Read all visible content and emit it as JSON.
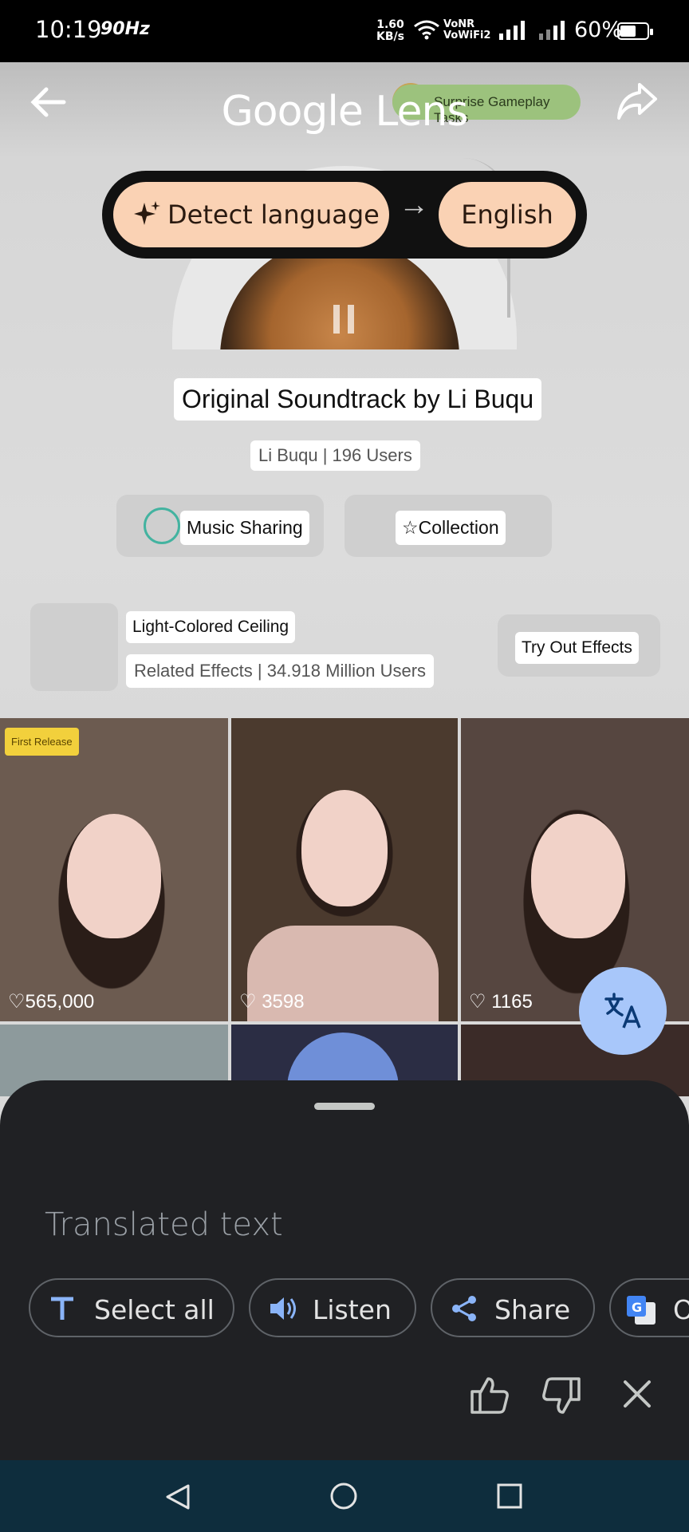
{
  "status_bar": {
    "time": "10:19",
    "refresh": "90Hz",
    "net_speed_value": "1.60",
    "net_speed_unit": "KB/s",
    "volte_top": "VoNR",
    "volte_bottom": "VoWiFi2",
    "battery": "60%",
    "battery_level": 0.6
  },
  "header": {
    "title": "Google Lens",
    "back_icon": "back-arrow-icon",
    "share_icon": "share-icon",
    "surprise_label": "Surprise Gameplay Tasks"
  },
  "language_bar": {
    "source": "Detect language",
    "target": "English",
    "colors": {
      "pill": "#fad2b4",
      "bar": "#111111"
    }
  },
  "song": {
    "title": "Original Soundtrack by Li Buqu",
    "users": "Li Buqu | 196 Users"
  },
  "actions": {
    "music_sharing": "Music Sharing",
    "collection": "☆Collection"
  },
  "effects": {
    "name": "Light-Colored Ceiling",
    "related": "Related Effects | 34.918 Million Users",
    "try_out": "Try Out Effects"
  },
  "grid": {
    "first_release": "First Release",
    "likes": [
      "♡565,000",
      "3598",
      "1165"
    ]
  },
  "sheet": {
    "translated_placeholder": "Translated text",
    "buttons": [
      "Select all",
      "Listen",
      "Share",
      "O"
    ]
  },
  "colors": {
    "sheet": "#202124",
    "fab": "#a8c7fa",
    "navbar": "#0e2d3d"
  }
}
